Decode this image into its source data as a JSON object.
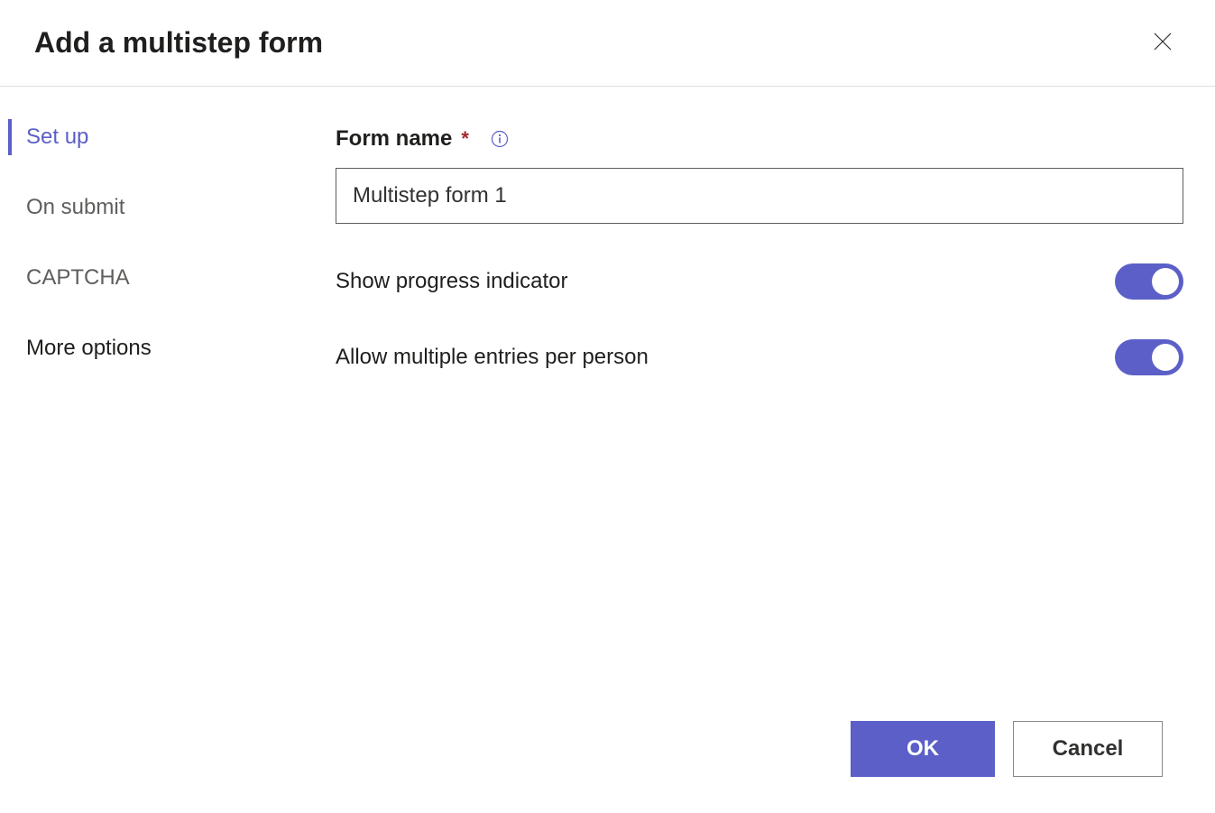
{
  "header": {
    "title": "Add a multistep form"
  },
  "sidebar": {
    "items": [
      {
        "label": "Set up",
        "active": true
      },
      {
        "label": "On submit",
        "active": false
      },
      {
        "label": "CAPTCHA",
        "active": false
      },
      {
        "label": "More options",
        "active": false
      }
    ]
  },
  "form": {
    "name_label": "Form name",
    "required_mark": "*",
    "name_value": "Multistep form 1",
    "show_progress_label": "Show progress indicator",
    "show_progress_on": true,
    "allow_multiple_label": "Allow multiple entries per person",
    "allow_multiple_on": true
  },
  "footer": {
    "ok_label": "OK",
    "cancel_label": "Cancel"
  }
}
